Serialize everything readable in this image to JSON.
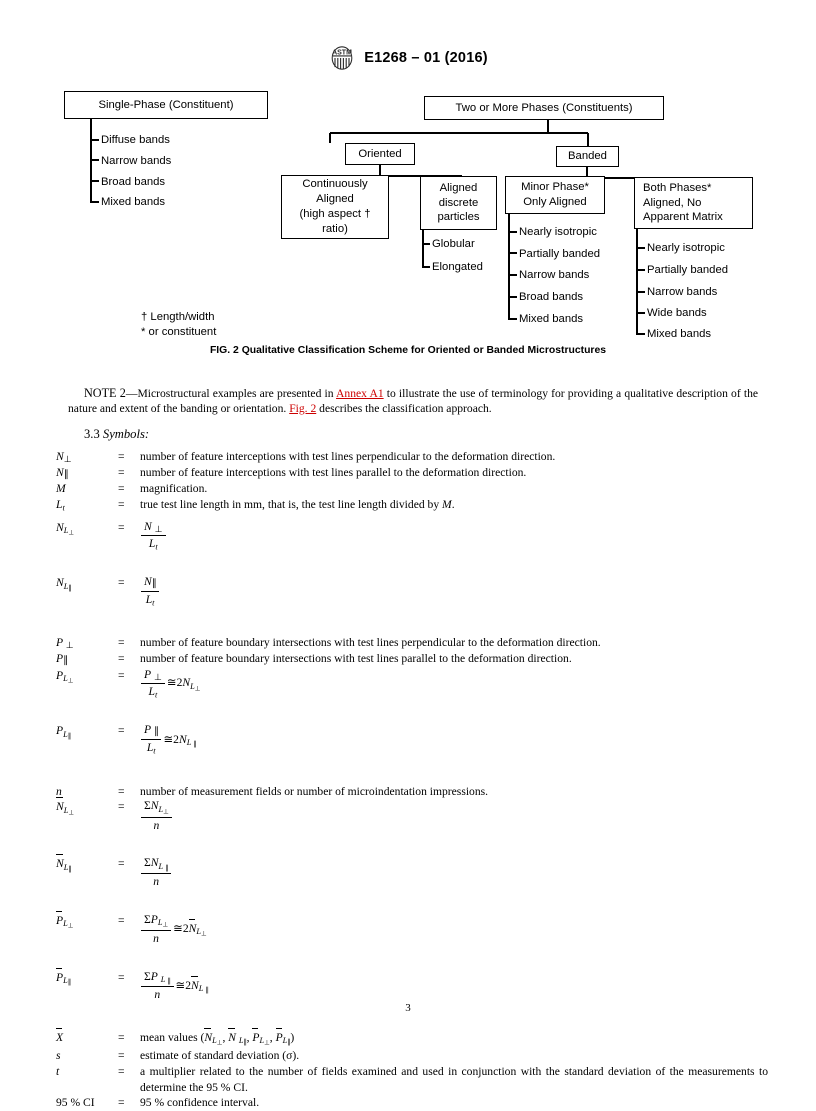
{
  "header": {
    "logo_icon": "astm-logo-icon",
    "designation": "E1268 – 01 (2016)"
  },
  "figure": {
    "caption": "FIG. 2  Qualitative Classification Scheme for Oriented or Banded Microstructures",
    "footnotes": [
      "† Length/width",
      "* or constituent"
    ],
    "nodes": {
      "single_phase": "Single-Phase (Constituent)",
      "two_or_more": "Two or More Phases (Constituents)",
      "oriented": "Oriented",
      "banded": "Banded",
      "continuously_aligned": "Continuously\nAligned\n(high aspect †\nratio)",
      "aligned_discrete": "Aligned\ndiscrete\nparticles",
      "minor_phase": "Minor Phase*\nOnly Aligned",
      "both_phases": "Both Phases*\nAligned, No\nApparent Matrix"
    },
    "lists": {
      "single_phase": [
        "Diffuse bands",
        "Narrow bands",
        "Broad bands",
        "Mixed bands"
      ],
      "aligned_discrete": [
        "Globular",
        "Elongated"
      ],
      "minor_phase": [
        "Nearly isotropic",
        "Partially banded",
        "Narrow bands",
        "Broad bands",
        "Mixed bands"
      ],
      "both_phases": [
        "Nearly isotropic",
        "Partially banded",
        "Narrow bands",
        "Wide bands",
        "Mixed bands"
      ]
    }
  },
  "note2": {
    "label": "NOTE 2",
    "dash": "—",
    "text_a": "Microstructural examples are presented in ",
    "link_annex": "Annex A1",
    "text_b": " to illustrate the use of terminology for providing a qualitative description of the nature and extent of the banding or orientation. ",
    "link_fig": "Fig. 2",
    "text_c": " describes the classification approach."
  },
  "section": {
    "number": "3.3",
    "title": "Symbols:"
  },
  "symbols": [
    {
      "symbol": "N⊥",
      "eq": "=",
      "definition": "number of feature interceptions with test lines perpendicular to the deformation direction."
    },
    {
      "symbol": "N∥",
      "eq": "=",
      "definition": "number of feature interceptions with test lines parallel to the deformation direction."
    },
    {
      "symbol": "M",
      "eq": "=",
      "definition": "magnification."
    },
    {
      "symbol": "Lt",
      "eq": "=",
      "definition": "true test line length in mm, that is, the test line length divided by M."
    },
    {
      "symbol": "NL⊥",
      "eq": "=",
      "definition": "N⊥ / Lt"
    },
    {
      "symbol": "NL∥",
      "eq": "=",
      "definition": "N∥ / Lt"
    },
    {
      "symbol": "P⊥",
      "eq": "=",
      "definition": "number of feature boundary intersections with test lines perpendicular to the deformation direction."
    },
    {
      "symbol": "P∥",
      "eq": "=",
      "definition": "number of feature boundary intersections with test lines parallel to the deformation direction."
    },
    {
      "symbol": "PL⊥",
      "eq": "=",
      "definition": "P⊥ / Lt ≅ 2NL⊥"
    },
    {
      "symbol": "PL∥",
      "eq": "=",
      "definition": "P∥ / Lt ≅ 2NL∥"
    },
    {
      "symbol": "n",
      "eq": "=",
      "definition": "number of measurement fields or number of microindentation impressions."
    },
    {
      "symbol": "N̄L⊥",
      "eq": "=",
      "definition": "ΣNL⊥ / n"
    },
    {
      "symbol": "N̄L∥",
      "eq": "=",
      "definition": "ΣNL∥ / n"
    },
    {
      "symbol": "P̄L⊥",
      "eq": "=",
      "definition": "ΣPL⊥ / n ≅ 2N̄L⊥"
    },
    {
      "symbol": "P̄L∥",
      "eq": "=",
      "definition": "ΣPL∥ / n ≅ 2N̄L∥"
    },
    {
      "symbol": "X̄",
      "eq": "=",
      "definition": "mean values (N̄L⊥, N̄L∥, P̄L⊥, P̄L∥)"
    },
    {
      "symbol": "s",
      "eq": "=",
      "definition": "estimate of standard deviation (σ)."
    },
    {
      "symbol": "t",
      "eq": "=",
      "definition": "a multiplier related to the number of fields examined and used in conjunction with the standard deviation of the measurements to determine the 95 % CI."
    },
    {
      "symbol": "95 % CI",
      "eq": "=",
      "definition": "95 % confidence interval."
    }
  ],
  "symbol_text": {
    "n_perp_def": "number of feature interceptions with test lines perpendicular to the deformation direction.",
    "n_par_def": "number of feature interceptions with test lines parallel to the deformation direction.",
    "m_def": "magnification.",
    "lt_def_a": "true test line length in mm, that is, the test line length divided by ",
    "lt_def_m": "M",
    "lt_def_b": ".",
    "p_perp_def": "number of feature boundary intersections with test lines perpendicular to the deformation direction.",
    "p_par_def": "number of feature boundary intersections with test lines parallel to the deformation direction.",
    "n_def": "number of measurement fields or number of microindentation impressions.",
    "x_def_pre": "mean values (",
    "x_def_post": ")",
    "s_def": "estimate of standard deviation (σ).",
    "t_def": "a multiplier related to the number of fields examined and used in conjunction with the standard deviation of the measurements to determine the 95 % CI.",
    "ci_label": "95 % CI",
    "ci_def": "95 % confidence interval.",
    "eq": "="
  },
  "footer": {
    "page_number": "3"
  }
}
